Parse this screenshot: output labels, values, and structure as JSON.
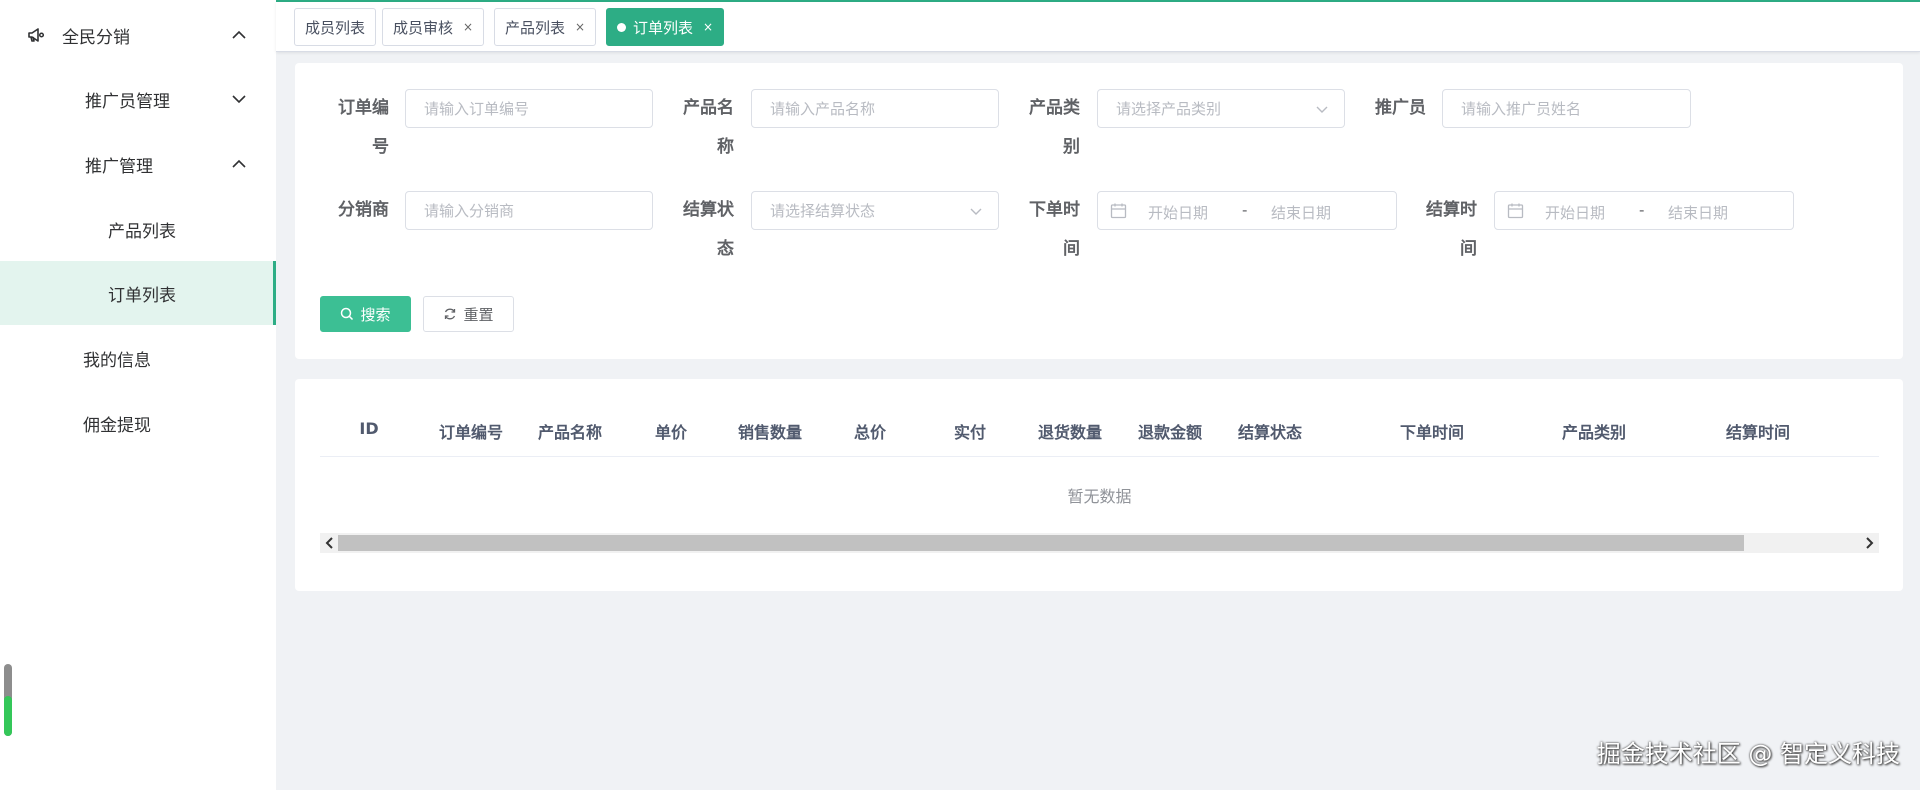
{
  "colors": {
    "accent": "#2dad85",
    "active_bg": "#e3f4ee",
    "primary_button": "#3cbf94"
  },
  "sidebar": {
    "root": {
      "label": "全民分销",
      "icon": "megaphone-icon",
      "expanded": true
    },
    "items": [
      {
        "label": "推广员管理",
        "expanded": false
      },
      {
        "label": "推广管理",
        "expanded": true
      },
      {
        "label": "产品列表"
      },
      {
        "label": "订单列表",
        "active": true
      },
      {
        "label": "我的信息"
      },
      {
        "label": "佣金提现"
      }
    ]
  },
  "tabs": [
    {
      "label": "成员列表",
      "closable": false
    },
    {
      "label": "成员审核",
      "closable": true
    },
    {
      "label": "产品列表",
      "closable": true
    },
    {
      "label": "订单列表",
      "closable": true,
      "active": true
    }
  ],
  "tab_close": "×",
  "search": {
    "order_no": {
      "label_lines": [
        "订单编",
        "号"
      ],
      "placeholder": "请输入订单编号"
    },
    "product_name": {
      "label_lines": [
        "产品名",
        "称"
      ],
      "placeholder": "请输入产品名称"
    },
    "product_type": {
      "label_lines": [
        "产品类",
        "别"
      ],
      "placeholder": "请选择产品类别"
    },
    "promoter": {
      "label_lines": [
        "推广员"
      ],
      "placeholder": "请输入推广员姓名"
    },
    "distributor": {
      "label_lines": [
        "分销商"
      ],
      "placeholder": "请输入分销商"
    },
    "settle_status": {
      "label_lines": [
        "结算状",
        "态"
      ],
      "placeholder": "请选择结算状态"
    },
    "order_time": {
      "label_lines": [
        "下单时",
        "间"
      ],
      "start": "开始日期",
      "separator": "-",
      "end": "结束日期"
    },
    "settle_time": {
      "label_lines": [
        "结算时",
        "间"
      ],
      "start": "开始日期",
      "separator": "-",
      "end": "结束日期"
    },
    "search_button": "搜索",
    "reset_button": "重置"
  },
  "table": {
    "columns": [
      "ID",
      "订单编号",
      "产品名称",
      "单价",
      "销售数量",
      "总价",
      "实付",
      "退货数量",
      "退款金额",
      "结算状态",
      "下单时间",
      "产品类别",
      "结算时间"
    ],
    "rows": [],
    "empty_text": "暂无数据"
  },
  "watermark": "掘金技术社区 @ 智定义科技",
  "side_gauge": {
    "level": 0.55
  }
}
